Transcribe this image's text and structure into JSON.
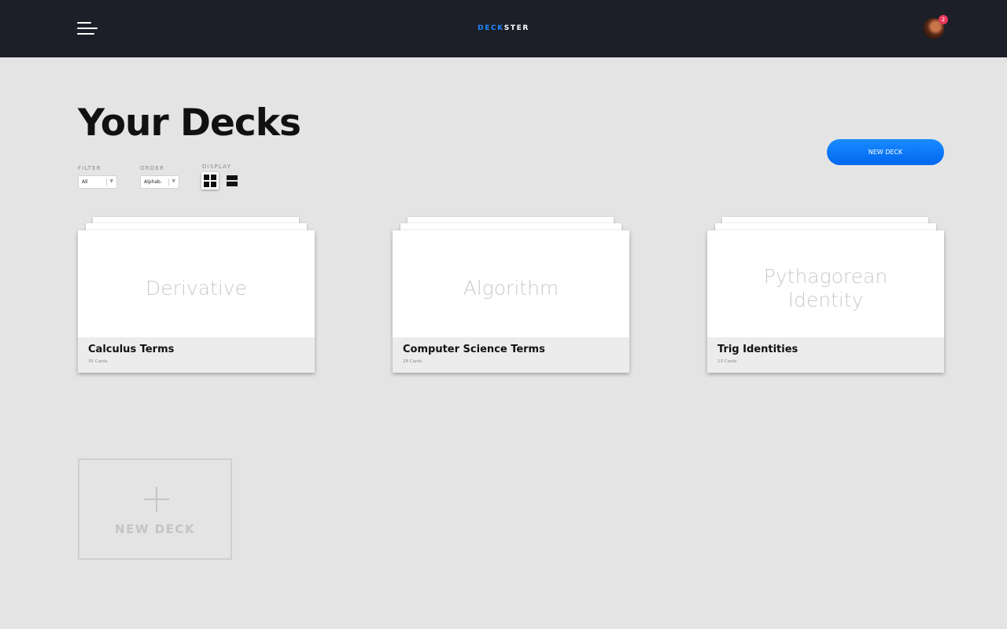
{
  "header": {
    "brand_part1": "DECK",
    "brand_part2": "STER",
    "notification_count": "2"
  },
  "page": {
    "title": "Your Decks"
  },
  "controls": {
    "filter_label": "FILTER",
    "filter_value": "All",
    "order_label": "ORDER",
    "order_value": "Alphab.",
    "display_label": "DISPLAY",
    "new_deck_button": "NEW DECK"
  },
  "decks": [
    {
      "term": "Derivative",
      "name": "Calculus Terms",
      "count": "35 Cards"
    },
    {
      "term": "Algorithm",
      "name": "Computer Science Terms",
      "count": "28 Cards"
    },
    {
      "term": "Pythagorean Identity",
      "name": "Trig Identities",
      "count": "13 Cards"
    }
  ],
  "add_tile": {
    "label": "NEW DECK"
  },
  "colors": {
    "topbar": "#1c1f28",
    "accent": "#1e88ff",
    "background": "#e4e4e4",
    "badge": "#e8385a"
  }
}
